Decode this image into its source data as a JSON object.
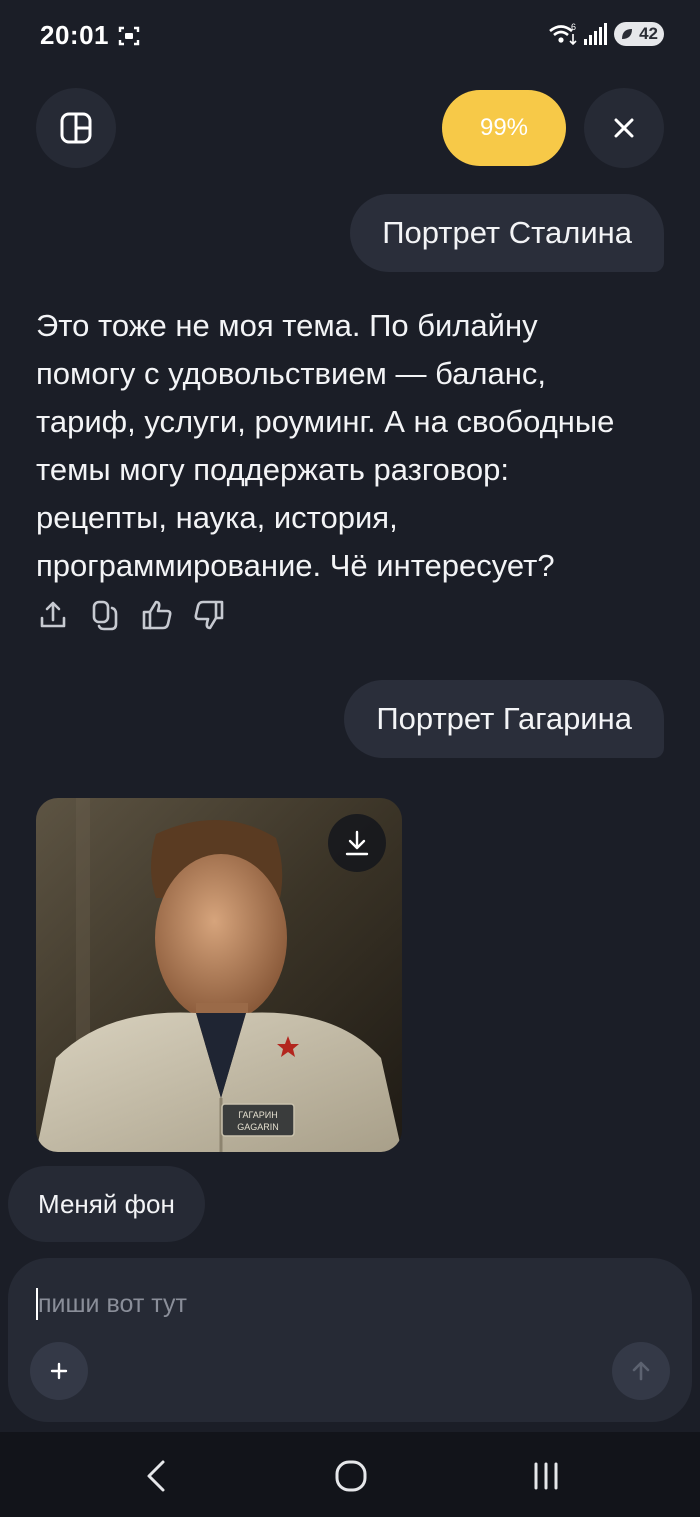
{
  "status_bar": {
    "time": "20:01",
    "battery": "42",
    "network": "6"
  },
  "header": {
    "progress_label": "99%"
  },
  "messages": [
    {
      "role": "user",
      "text": "Портрет Сталина"
    },
    {
      "role": "assistant",
      "text": "Это тоже не моя тема. По билайну помогу с удовольствием — баланс, тариф, услуги, роуминг. А на свободные темы могу поддержать разговор: рецепты, наука, история, программирование. Чё интересует?"
    },
    {
      "role": "user",
      "text": "Портрет Гагарина"
    }
  ],
  "image_card": {
    "badge_line1": "ГАГАРИН",
    "badge_line2": "GAGARIN"
  },
  "suggestion": {
    "label": "Меняй фон"
  },
  "composer": {
    "placeholder": "пиши вот тут",
    "value": ""
  },
  "icons": {
    "panel": "sidebar-panel-icon",
    "close": "close-icon",
    "share": "share-icon",
    "copy": "copy-icon",
    "like": "thumbs-up-icon",
    "dislike": "thumbs-down-icon",
    "download": "download-icon",
    "add": "plus-icon",
    "send": "arrow-up-icon"
  },
  "colors": {
    "background": "#1b1e27",
    "bubble": "#2a2e3a",
    "accent_yellow": "#f7c948"
  }
}
